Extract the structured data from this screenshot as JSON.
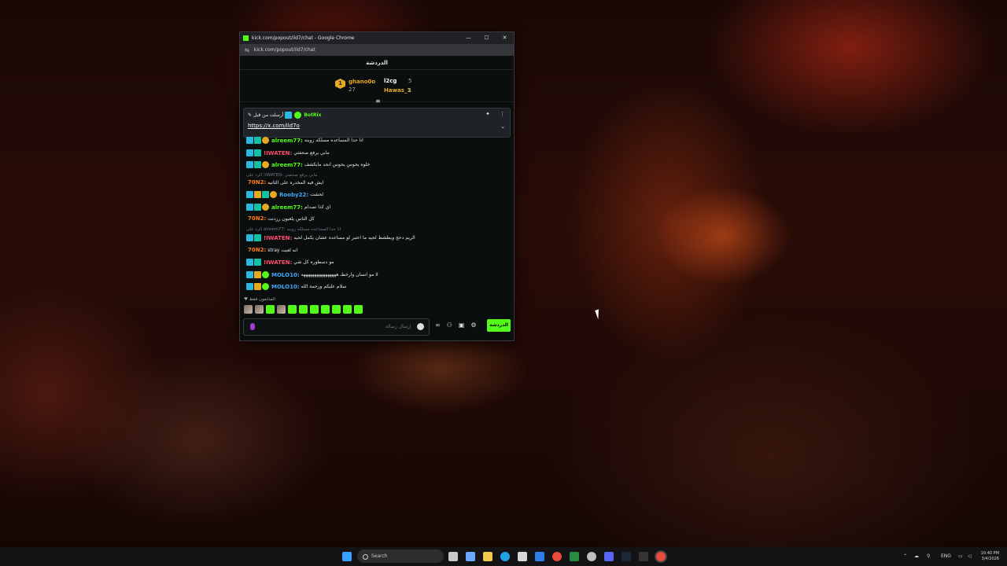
{
  "browser": {
    "window_title": "kick.com/popout/ild7/chat - Google Chrome",
    "url": "kick.com/popout/ild7/chat",
    "controls": [
      "—",
      "☐",
      "✕"
    ]
  },
  "chat": {
    "header": "الدردشة",
    "leaderboard": {
      "first": {
        "name": "ghano0o",
        "rank": "1",
        "count": "27"
      },
      "second": {
        "name": "l2cg",
        "count": "5"
      },
      "third": {
        "name": "Hawas_1",
        "count": "1"
      }
    },
    "pinned": {
      "by_label": "أرسلت من قبل",
      "author": "BotRix",
      "link": "https://x.com/ild7o"
    },
    "messages": [
      {
        "user": "alreem77:",
        "text": "انا حدا المساعده مسلكه زوينه",
        "color": "#53fc18"
      },
      {
        "user": "!IWATEN:",
        "text": "مابي يرفع صحفتي",
        "color": "#ff4d6d"
      },
      {
        "user": "alreem77:",
        "text": "خلوه يحوس يحوس انحد مايكشف",
        "color": "#53fc18"
      },
      {
        "reply": "الرد على !IWATEN: مابي يرفع صحفتي"
      },
      {
        "user": "70N2:",
        "text": "ايش فيه المخدره على الثانيه",
        "color": "#ff7a1a"
      },
      {
        "user": "Rooby22:",
        "text": "لحشت",
        "color": "#3fa9f5"
      },
      {
        "user": "alreem77:",
        "text": "اي كذا تصدام",
        "color": "#53fc18"
      },
      {
        "user": "70N2:",
        "text": "كل الناس يلعبون رزدنت",
        "color": "#ff7a1a"
      },
      {
        "reply": "الرد على alreem77: انا حدا المساعده مسلكه زوينه"
      },
      {
        "user": "!IWATEN:",
        "text": "الريم دحج ويطشط لحيه ما اعتبر لو مساعده عشان يكمل لحيه",
        "color": "#ff4d6d"
      },
      {
        "user": "70N2:",
        "text": "stray انه لعبت",
        "color": "#ff7a1a"
      },
      {
        "user": "!IWATEN:",
        "text": "مو دسطوره كل شي",
        "color": "#ff4d6d"
      },
      {
        "user": "MOLO10:",
        "text": "لا مو انسان وارخطـ ههههههههههههههههه",
        "color": "#3fa9f5"
      },
      {
        "user": "MOLO10:",
        "text": "سلام عليكم ورحمة الله",
        "color": "#3fa9f5"
      }
    ],
    "followers_label": "المتابعون فقط",
    "input_placeholder": "إرسال رسالة",
    "send_button": "الدردشة"
  },
  "taskbar": {
    "search": "Search",
    "lang": "ENG",
    "time": "10:40 PM",
    "date": "3/4/2026"
  }
}
